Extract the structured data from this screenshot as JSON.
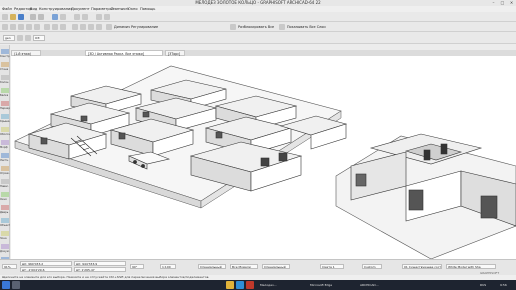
{
  "window": {
    "title": "МЕЛОДЕЗ ЗОЛОТОЕ КОЛЬЦО - GRAPHISOFT ARCHICAD-64 22",
    "min_glyph": "–",
    "max_glyph": "□",
    "close_glyph": "✕"
  },
  "menu": [
    "Файл",
    "Редактор",
    "Вид",
    "Конструирование",
    "Документ",
    "Параметры",
    "Teamwork",
    "Окно",
    "Помощь"
  ],
  "toolbar2": {
    "buttons": [
      "Динамич Регулирование",
      "Разблокировать Все",
      "Показывать Все Слои"
    ]
  },
  "infobar": {
    "floor": "gen",
    "floor_value": "ОЭ",
    "label_stories": "(1-й этаж)",
    "view_select": "[3D / Активная Раскл. Все этажи]",
    "view_tag": "[3Торс]"
  },
  "left_tools": [
    "Констр",
    "Стена",
    "Колон.",
    "Балка",
    "Перекр.",
    "Крыша",
    "Оболоч.",
    "Морф",
    "Лестн.",
    "Ограж.",
    "Навес.",
    "Окно",
    "Дверь",
    "Объект",
    "Зона",
    "Докум.",
    "Разное"
  ],
  "statusbar": {
    "coords": [
      "ΔX: 960'033,2",
      "ΔY: -1'004'29,6",
      "ΔX: 944'333,9",
      "ΔY: 1'265,47"
    ],
    "angle": "90°",
    "scale": "1:100",
    "layer_combo": "Специальный",
    "pen_set": "Все Модели",
    "model_view": "Специальный",
    "struct": "Смета 1",
    "renovation": "Custom",
    "scheme": "01 Существующее сост.",
    "mode_3d": "White Model with Sha",
    "zoom": "91%",
    "brand": "GRAPHISOFT"
  },
  "hint": "Щелкните на элементе для его выбора. Нажмите и не отпускайте Ctrl+Shift для переключения выбора элементов/подэлементов.",
  "taskbar": {
    "search_icon": "search-icon",
    "tasks": [
      "Мелодез...",
      "Microsoft Edge",
      "ARCHICAD..."
    ],
    "time": "9:56",
    "lang": "RUS"
  },
  "colors": {
    "accent": "#2a6cc9",
    "viewport_bg": "#ffffff",
    "taskbar": "#1e2430"
  }
}
